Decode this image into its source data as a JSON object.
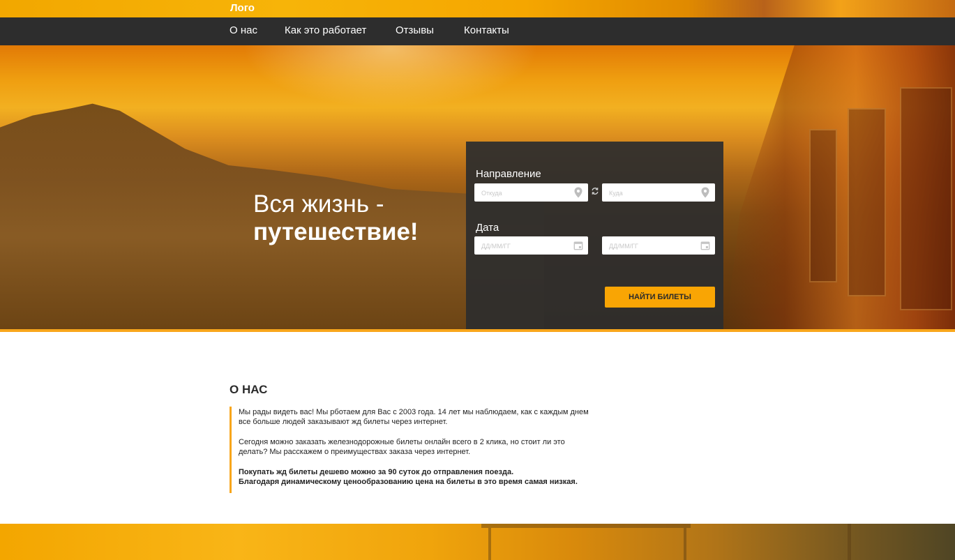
{
  "header": {
    "logo": "Лого",
    "nav": [
      "О нас",
      "Как это работает",
      "Отзывы",
      "Контакты"
    ]
  },
  "hero": {
    "title_light": "Вся жизнь -",
    "title_bold": "путешествие!"
  },
  "search": {
    "direction_label": "Направление",
    "from_placeholder": "Откуда",
    "to_placeholder": "Куда",
    "date_label": "Дата",
    "date_from_placeholder": "ДД/ММ/ГГ",
    "date_to_placeholder": "ДД/ММ/ГГ",
    "button_label": "НАЙТИ БИЛЕТЫ"
  },
  "about": {
    "title": "О НАС",
    "p1_line1": "Мы рады видеть вас! Мы рботаем для Вас с 2003 года. 14 лет мы наблюдаем, как с каждым днем",
    "p1_line2": "все больше людей заказывают жд билеты через интернет.",
    "p2_line1": "Сегодня можно заказать железнодорожные билеты онлайн всего в 2 клика, но стоит ли это",
    "p2_line2": "делать? Мы расскажем о преимуществах заказа через интернет.",
    "p3_line1": "Покупать жд билеты дешево можно за 90 суток до отправления поезда.",
    "p3_line2": "Благодаря динамическому ценообразованию цена на билеты в это время самая низкая."
  },
  "colors": {
    "accent": "#f9a504",
    "navbar": "#2d2d2d",
    "panel": "#2d2d2d"
  },
  "icons": {
    "from": "location-pin-icon",
    "to": "location-pin-icon",
    "swap": "swap-icon",
    "date": "calendar-icon"
  }
}
